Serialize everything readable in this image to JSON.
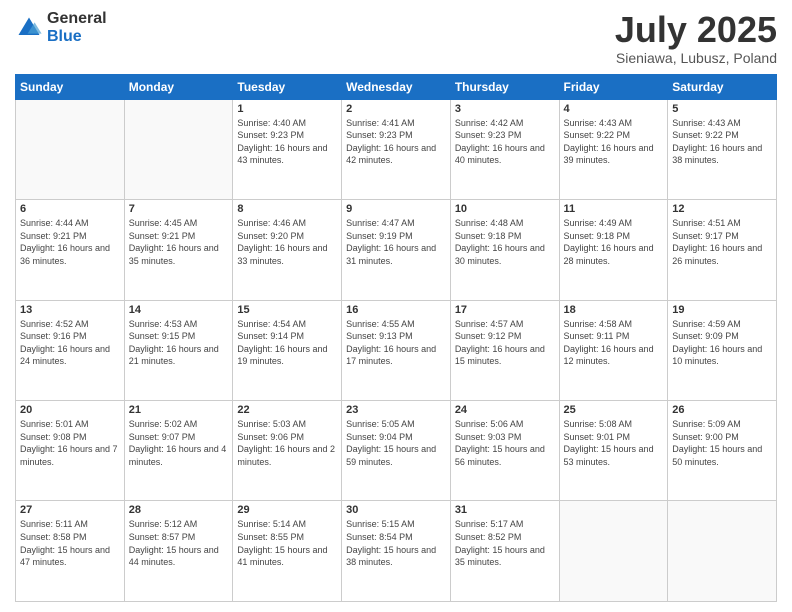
{
  "header": {
    "logo_general": "General",
    "logo_blue": "Blue",
    "title": "July 2025",
    "subtitle": "Sieniawa, Lubusz, Poland"
  },
  "calendar": {
    "days": [
      "Sunday",
      "Monday",
      "Tuesday",
      "Wednesday",
      "Thursday",
      "Friday",
      "Saturday"
    ],
    "weeks": [
      [
        {
          "day": "",
          "sunrise": "",
          "sunset": "",
          "daylight": "",
          "empty": true
        },
        {
          "day": "",
          "sunrise": "",
          "sunset": "",
          "daylight": "",
          "empty": true
        },
        {
          "day": "1",
          "sunrise": "Sunrise: 4:40 AM",
          "sunset": "Sunset: 9:23 PM",
          "daylight": "Daylight: 16 hours and 43 minutes.",
          "empty": false
        },
        {
          "day": "2",
          "sunrise": "Sunrise: 4:41 AM",
          "sunset": "Sunset: 9:23 PM",
          "daylight": "Daylight: 16 hours and 42 minutes.",
          "empty": false
        },
        {
          "day": "3",
          "sunrise": "Sunrise: 4:42 AM",
          "sunset": "Sunset: 9:23 PM",
          "daylight": "Daylight: 16 hours and 40 minutes.",
          "empty": false
        },
        {
          "day": "4",
          "sunrise": "Sunrise: 4:43 AM",
          "sunset": "Sunset: 9:22 PM",
          "daylight": "Daylight: 16 hours and 39 minutes.",
          "empty": false
        },
        {
          "day": "5",
          "sunrise": "Sunrise: 4:43 AM",
          "sunset": "Sunset: 9:22 PM",
          "daylight": "Daylight: 16 hours and 38 minutes.",
          "empty": false
        }
      ],
      [
        {
          "day": "6",
          "sunrise": "Sunrise: 4:44 AM",
          "sunset": "Sunset: 9:21 PM",
          "daylight": "Daylight: 16 hours and 36 minutes.",
          "empty": false
        },
        {
          "day": "7",
          "sunrise": "Sunrise: 4:45 AM",
          "sunset": "Sunset: 9:21 PM",
          "daylight": "Daylight: 16 hours and 35 minutes.",
          "empty": false
        },
        {
          "day": "8",
          "sunrise": "Sunrise: 4:46 AM",
          "sunset": "Sunset: 9:20 PM",
          "daylight": "Daylight: 16 hours and 33 minutes.",
          "empty": false
        },
        {
          "day": "9",
          "sunrise": "Sunrise: 4:47 AM",
          "sunset": "Sunset: 9:19 PM",
          "daylight": "Daylight: 16 hours and 31 minutes.",
          "empty": false
        },
        {
          "day": "10",
          "sunrise": "Sunrise: 4:48 AM",
          "sunset": "Sunset: 9:18 PM",
          "daylight": "Daylight: 16 hours and 30 minutes.",
          "empty": false
        },
        {
          "day": "11",
          "sunrise": "Sunrise: 4:49 AM",
          "sunset": "Sunset: 9:18 PM",
          "daylight": "Daylight: 16 hours and 28 minutes.",
          "empty": false
        },
        {
          "day": "12",
          "sunrise": "Sunrise: 4:51 AM",
          "sunset": "Sunset: 9:17 PM",
          "daylight": "Daylight: 16 hours and 26 minutes.",
          "empty": false
        }
      ],
      [
        {
          "day": "13",
          "sunrise": "Sunrise: 4:52 AM",
          "sunset": "Sunset: 9:16 PM",
          "daylight": "Daylight: 16 hours and 24 minutes.",
          "empty": false
        },
        {
          "day": "14",
          "sunrise": "Sunrise: 4:53 AM",
          "sunset": "Sunset: 9:15 PM",
          "daylight": "Daylight: 16 hours and 21 minutes.",
          "empty": false
        },
        {
          "day": "15",
          "sunrise": "Sunrise: 4:54 AM",
          "sunset": "Sunset: 9:14 PM",
          "daylight": "Daylight: 16 hours and 19 minutes.",
          "empty": false
        },
        {
          "day": "16",
          "sunrise": "Sunrise: 4:55 AM",
          "sunset": "Sunset: 9:13 PM",
          "daylight": "Daylight: 16 hours and 17 minutes.",
          "empty": false
        },
        {
          "day": "17",
          "sunrise": "Sunrise: 4:57 AM",
          "sunset": "Sunset: 9:12 PM",
          "daylight": "Daylight: 16 hours and 15 minutes.",
          "empty": false
        },
        {
          "day": "18",
          "sunrise": "Sunrise: 4:58 AM",
          "sunset": "Sunset: 9:11 PM",
          "daylight": "Daylight: 16 hours and 12 minutes.",
          "empty": false
        },
        {
          "day": "19",
          "sunrise": "Sunrise: 4:59 AM",
          "sunset": "Sunset: 9:09 PM",
          "daylight": "Daylight: 16 hours and 10 minutes.",
          "empty": false
        }
      ],
      [
        {
          "day": "20",
          "sunrise": "Sunrise: 5:01 AM",
          "sunset": "Sunset: 9:08 PM",
          "daylight": "Daylight: 16 hours and 7 minutes.",
          "empty": false
        },
        {
          "day": "21",
          "sunrise": "Sunrise: 5:02 AM",
          "sunset": "Sunset: 9:07 PM",
          "daylight": "Daylight: 16 hours and 4 minutes.",
          "empty": false
        },
        {
          "day": "22",
          "sunrise": "Sunrise: 5:03 AM",
          "sunset": "Sunset: 9:06 PM",
          "daylight": "Daylight: 16 hours and 2 minutes.",
          "empty": false
        },
        {
          "day": "23",
          "sunrise": "Sunrise: 5:05 AM",
          "sunset": "Sunset: 9:04 PM",
          "daylight": "Daylight: 15 hours and 59 minutes.",
          "empty": false
        },
        {
          "day": "24",
          "sunrise": "Sunrise: 5:06 AM",
          "sunset": "Sunset: 9:03 PM",
          "daylight": "Daylight: 15 hours and 56 minutes.",
          "empty": false
        },
        {
          "day": "25",
          "sunrise": "Sunrise: 5:08 AM",
          "sunset": "Sunset: 9:01 PM",
          "daylight": "Daylight: 15 hours and 53 minutes.",
          "empty": false
        },
        {
          "day": "26",
          "sunrise": "Sunrise: 5:09 AM",
          "sunset": "Sunset: 9:00 PM",
          "daylight": "Daylight: 15 hours and 50 minutes.",
          "empty": false
        }
      ],
      [
        {
          "day": "27",
          "sunrise": "Sunrise: 5:11 AM",
          "sunset": "Sunset: 8:58 PM",
          "daylight": "Daylight: 15 hours and 47 minutes.",
          "empty": false
        },
        {
          "day": "28",
          "sunrise": "Sunrise: 5:12 AM",
          "sunset": "Sunset: 8:57 PM",
          "daylight": "Daylight: 15 hours and 44 minutes.",
          "empty": false
        },
        {
          "day": "29",
          "sunrise": "Sunrise: 5:14 AM",
          "sunset": "Sunset: 8:55 PM",
          "daylight": "Daylight: 15 hours and 41 minutes.",
          "empty": false
        },
        {
          "day": "30",
          "sunrise": "Sunrise: 5:15 AM",
          "sunset": "Sunset: 8:54 PM",
          "daylight": "Daylight: 15 hours and 38 minutes.",
          "empty": false
        },
        {
          "day": "31",
          "sunrise": "Sunrise: 5:17 AM",
          "sunset": "Sunset: 8:52 PM",
          "daylight": "Daylight: 15 hours and 35 minutes.",
          "empty": false
        },
        {
          "day": "",
          "sunrise": "",
          "sunset": "",
          "daylight": "",
          "empty": true
        },
        {
          "day": "",
          "sunrise": "",
          "sunset": "",
          "daylight": "",
          "empty": true
        }
      ]
    ]
  }
}
